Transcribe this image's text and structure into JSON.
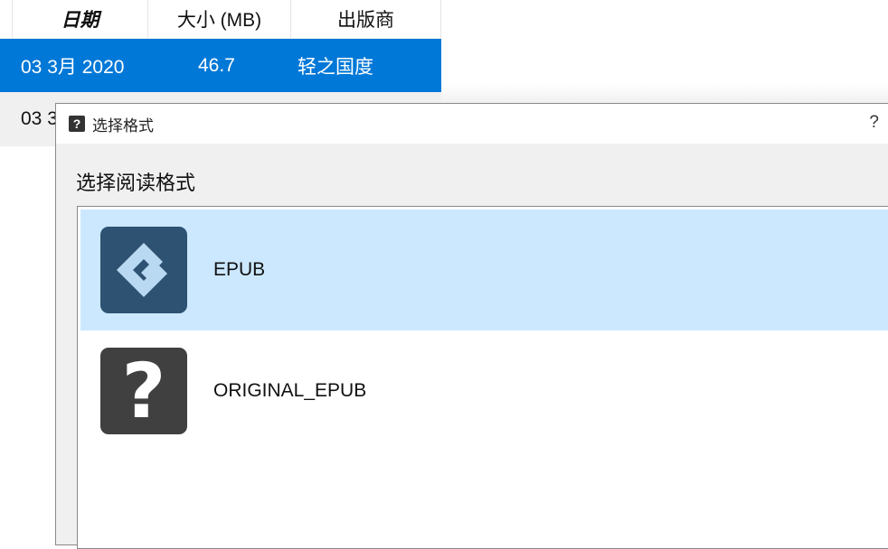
{
  "table": {
    "headers": [
      "日期",
      "大小 (MB)",
      "出版商"
    ],
    "rows": [
      {
        "date": "03 3月 2020",
        "size": "46.7",
        "publisher": "轻之国度"
      },
      {
        "date": "03 3"
      }
    ]
  },
  "dialog": {
    "title": "选择格式",
    "help": "?",
    "prompt": "选择阅读格式",
    "formats": [
      {
        "label": "EPUB",
        "icon": "epub-icon"
      },
      {
        "label": "ORIGINAL_EPUB",
        "icon": "unknown-format-icon"
      }
    ]
  },
  "colors": {
    "selection": "#0078d7",
    "list_selection": "#cce8ff"
  }
}
